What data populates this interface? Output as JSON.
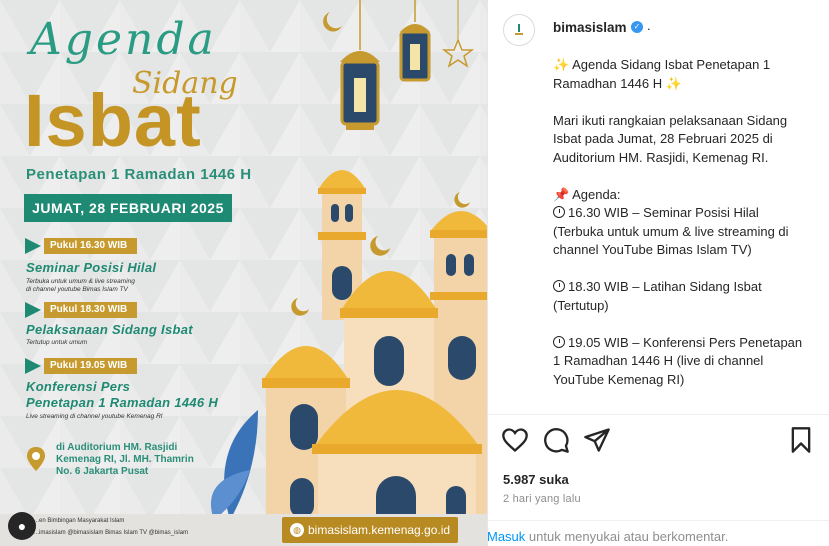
{
  "poster": {
    "title_script": "Agenda",
    "title_sidang": "Sidang",
    "title_isbat": "Isbat",
    "subtitle": "Penetapan 1 Ramadan 1446 H",
    "date_banner": "JUMAT, 28 FEBRUARI 2025",
    "items": [
      {
        "time": "Pukul 16.30 WIB",
        "title": "Seminar Posisi Hilal",
        "sub1": "Terbuka untuk umum & live streaming",
        "sub2": "di channel youtube Bimas Islam TV"
      },
      {
        "time": "Pukul 18.30 WIB",
        "title": "Pelaksanaan Sidang Isbat",
        "sub1": "Tertutup untuk umum",
        "sub2": ""
      },
      {
        "time": "Pukul 19.05 WIB",
        "title": "Konferensi Pers",
        "title2": "Penetapan 1 Ramadan 1446 H",
        "sub1": "Live streaming di channel youtube Kemenag RI",
        "sub2": ""
      }
    ],
    "location_line1": "di Auditorium HM. Rasjidi",
    "location_line2": "Kemenag RI, Jl. MH. Thamrin",
    "location_line3": "No. 6 Jakarta Pusat",
    "footer_line1": "...en Bimbingan Masyarakat Islam",
    "footer_line2": "...imasislam   @bimasislam   Bimas Islam TV   @bimas_islam",
    "url": "bimasislam.kemenag.go.id",
    "colors": {
      "green": "#1f8a73",
      "gold": "#c49525",
      "background": "#e9eaea"
    }
  },
  "post": {
    "username": "bimasislam",
    "header_dot": ".",
    "caption": {
      "line1": "Agenda Sidang Isbat Penetapan 1 Ramadhan 1446 H",
      "para1": "Mari ikuti rangkaian pelaksanaan Sidang Isbat pada Jumat, 28 Februari 2025 di Auditorium HM. Rasjidi, Kemenag RI.",
      "agenda_label": "Agenda:",
      "item1": "16.30 WIB – Seminar Posisi Hilal (Terbuka untuk umum & live streaming di channel YouTube Bimas Islam TV)",
      "item2": "18.30 WIB – Latihan Sidang Isbat (Tertutup)",
      "item3": "19.05 WIB – Konferensi Pers Penetapan 1 Ramadhan 1446 H (live di channel YouTube Kemenag RI)"
    },
    "likes": "5.987 suka",
    "time_ago": "2 hari yang lalu",
    "login_link": "Masuk",
    "login_rest": " untuk menyukai atau berkomentar.",
    "icons": [
      "heart-icon",
      "comment-icon",
      "share-icon",
      "bookmark-icon",
      "verified-badge-icon"
    ]
  }
}
